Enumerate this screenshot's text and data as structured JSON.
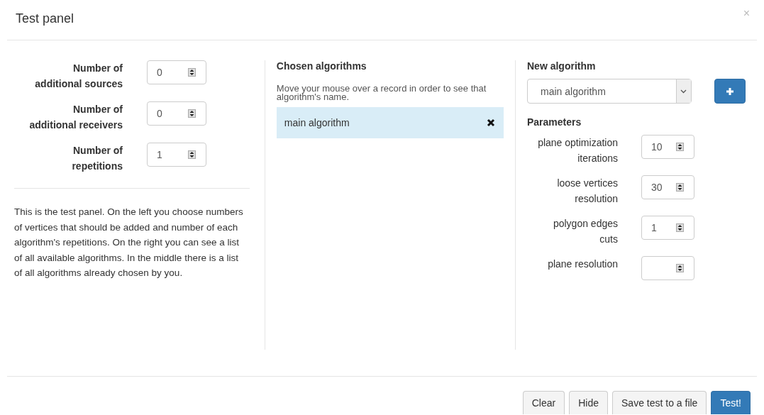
{
  "modal": {
    "title": "Test panel",
    "close": "×"
  },
  "left": {
    "fields": [
      {
        "label": "Number of additional sources",
        "value": "0"
      },
      {
        "label": "Number of additional receivers",
        "value": "0"
      },
      {
        "label": "Number of repetitions",
        "value": "1"
      }
    ],
    "description": "This is the test panel. On the left you choose numbers of vertices that should be added and number of each algorithm's repetitions. On the right you can see a list of all available algorithms. In the middle there is a list of all algorithms already chosen by you."
  },
  "middle": {
    "heading": "Chosen algorithms",
    "hint": "Move your mouse over a record in order to see that algorithm's name.",
    "records": [
      {
        "name": "main algorithm"
      }
    ]
  },
  "right": {
    "heading": "New algorithm",
    "select": {
      "value": "main algorithm"
    },
    "parameters_heading": "Parameters",
    "parameters": [
      {
        "label": "plane optimization iterations",
        "value": "10"
      },
      {
        "label": "loose vertices resolution",
        "value": "30"
      },
      {
        "label": "polygon edges cuts",
        "value": "1"
      },
      {
        "label": "plane resolution"
      }
    ]
  },
  "footer": {
    "buttons": [
      {
        "label": "Clear",
        "kind": "default"
      },
      {
        "label": "Hide",
        "kind": "default"
      },
      {
        "label": "Save test to a file",
        "kind": "default"
      },
      {
        "label": "Test!",
        "kind": "primary"
      }
    ]
  }
}
